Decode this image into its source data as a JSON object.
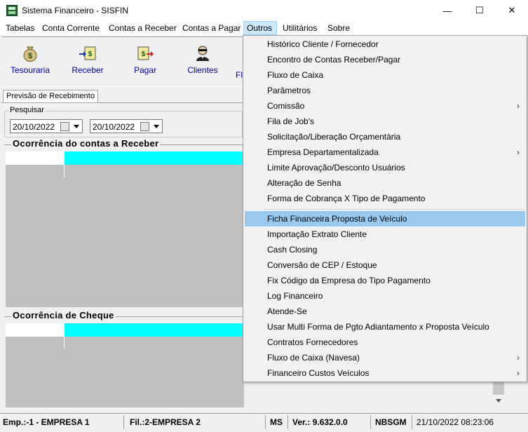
{
  "window": {
    "title": "Sistema Financeiro - SISFIN",
    "minimize": "—",
    "maximize": "☐",
    "close": "✕"
  },
  "menubar": [
    "Tabelas",
    "Conta Corrente",
    "Contas a Receber",
    "Contas a Pagar",
    "Outros",
    "Utilitários",
    "Sobre"
  ],
  "toolbar": {
    "tesouraria": "Tesouraria",
    "receber": "Receber",
    "pagar": "Pagar",
    "clientes": "Clientes",
    "partial": "Fl"
  },
  "tab": {
    "label": "Previsão de Recebimento"
  },
  "search": {
    "label": "Pesquisar",
    "date_from": "20/10/2022",
    "date_to": "20/10/2022"
  },
  "sections": {
    "receber_title": "Ocorrência do contas a Receber",
    "cheque_title": "Ocorrência de Cheque"
  },
  "status": {
    "empresa": "Emp.:-1 - EMPRESA 1",
    "filial": "Fil.:2-EMPRESA 2",
    "uf": "MS",
    "versao": "Ver.: 9.632.0.0",
    "sistema": "NBSGM",
    "datetime": "21/10/2022 08:23:06"
  },
  "outros_menu": {
    "items": [
      {
        "label": "Histórico Cliente / Fornecedor",
        "submenu": false
      },
      {
        "label": "Encontro de Contas Receber/Pagar",
        "submenu": false
      },
      {
        "label": "Fluxo de Caixa",
        "submenu": false
      },
      {
        "label": "Parâmetros",
        "submenu": false
      },
      {
        "label": "Comissão",
        "submenu": true
      },
      {
        "label": "Fila de Job's",
        "submenu": false
      },
      {
        "label": "Solicitação/Liberação Orçamentária",
        "submenu": false
      },
      {
        "label": "Empresa Departamentalizada",
        "submenu": true
      },
      {
        "label": "Limite Aprovação/Desconto Usuários",
        "submenu": false
      },
      {
        "label": "Alteração de Senha",
        "submenu": false
      },
      {
        "label": "Forma de Cobrança X Tipo de Pagamento",
        "submenu": false
      },
      {
        "label": "Ficha Financeira Proposta de Veículo",
        "submenu": false,
        "highlighted": true
      },
      {
        "label": "Importação Extrato Cliente",
        "submenu": false
      },
      {
        "label": "Cash Closing",
        "submenu": false
      },
      {
        "label": "Conversão de CEP / Estoque",
        "submenu": false
      },
      {
        "label": "Fix  Código da Empresa do Tipo Pagamento",
        "submenu": false
      },
      {
        "label": "Log Financeiro",
        "submenu": false
      },
      {
        "label": "Atende-Se",
        "submenu": false
      },
      {
        "label": "Usar Multi Forma de Pgto  Adiantamento x Proposta Veículo",
        "submenu": false
      },
      {
        "label": "Contratos Fornecedores",
        "submenu": false
      },
      {
        "label": "Fluxo de Caixa (Navesa)",
        "submenu": true
      },
      {
        "label": "Financeiro Custos Veículos",
        "submenu": true
      }
    ],
    "submenu_arrow": "›"
  },
  "colors": {
    "grid_header": "#00ffff",
    "grid_body": "#c0c0c0",
    "menu_highlight": "#99c9ef",
    "active_menu": "#cce8ff"
  },
  "icons": [
    "money-bag-icon",
    "receive-icon",
    "pay-icon",
    "client-icon",
    "calendar-icon"
  ]
}
